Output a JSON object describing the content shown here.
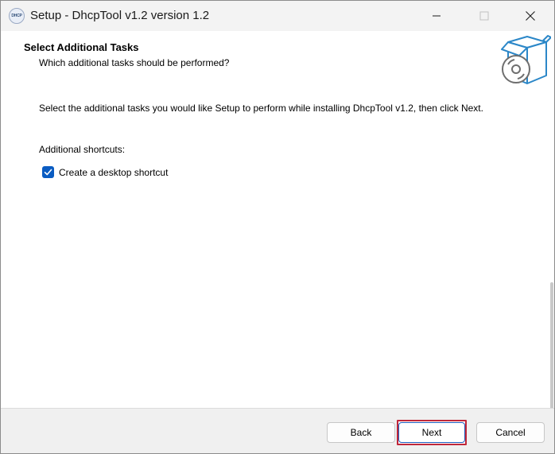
{
  "window": {
    "title": "Setup - DhcpTool v1.2 version 1.2",
    "app_icon_text": "DHCP"
  },
  "header": {
    "title": "Select Additional Tasks",
    "subtitle": "Which additional tasks should be performed?"
  },
  "content": {
    "instructions": "Select the additional tasks you would like Setup to perform while installing DhcpTool v1.2, then click Next.",
    "group_label": "Additional shortcuts:",
    "tasks": [
      {
        "label": "Create a desktop shortcut",
        "checked": true
      }
    ]
  },
  "footer": {
    "back_label": "Back",
    "next_label": "Next",
    "cancel_label": "Cancel"
  },
  "colors": {
    "accent": "#0a5cc2",
    "highlight_border": "#c0273a",
    "art_blue": "#2b87c8"
  }
}
